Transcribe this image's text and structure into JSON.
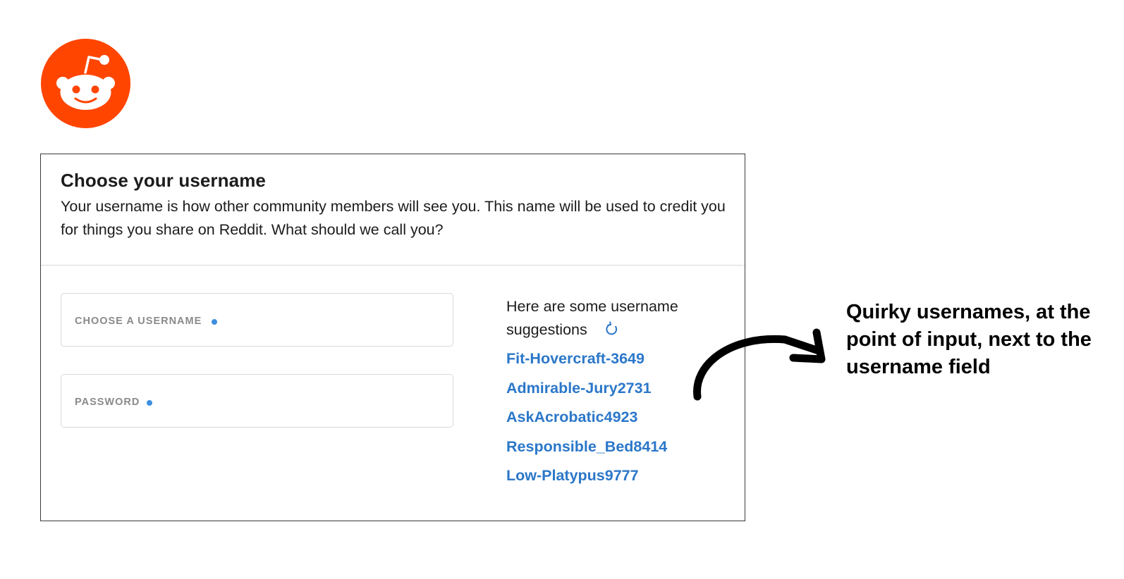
{
  "brand": {
    "logo_icon": "reddit-snoo-icon",
    "color": "#FF4500"
  },
  "signup": {
    "title": "Choose your username",
    "description": "Your username is how other community members will see you. This name will be used to credit you for things you share on Reddit. What should we call you?",
    "username_field": {
      "placeholder": "CHOOSE A USERNAME",
      "value": ""
    },
    "password_field": {
      "placeholder": "PASSWORD",
      "value": ""
    },
    "suggestions": {
      "heading_line1": "Here are some username",
      "heading_line2": "suggestions",
      "refresh_icon": "refresh-icon",
      "items": [
        "Fit-Hovercraft-3649",
        "Admirable-Jury2731",
        "AskAcrobatic4923",
        "Responsible_Bed8414",
        "Low-Platypus9777"
      ]
    }
  },
  "annotation": {
    "text": "Quirky usernames, at the point of input, next to the username field",
    "arrow_icon": "curved-arrow-icon"
  },
  "colors": {
    "link": "#2B77C9",
    "required_dot": "#3D8FE0",
    "brand": "#FF4500"
  }
}
